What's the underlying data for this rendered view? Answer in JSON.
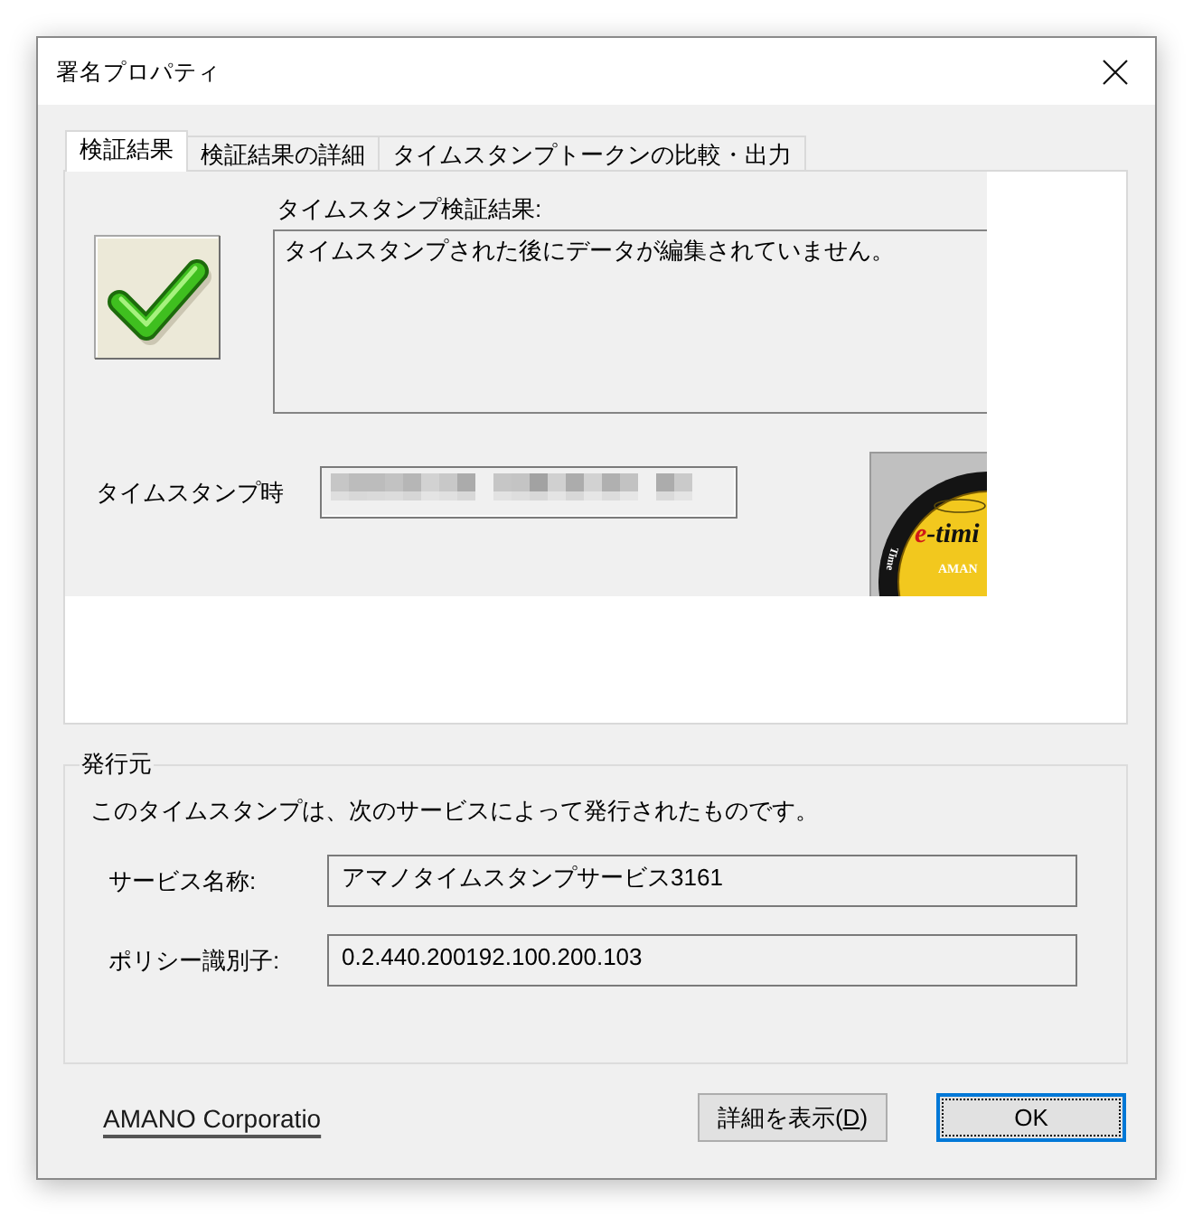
{
  "window": {
    "title": "署名プロパティ"
  },
  "tabs": [
    {
      "label": "検証結果",
      "selected": true
    },
    {
      "label": "検証結果の詳細",
      "selected": false
    },
    {
      "label": "タイムスタンプトークンの比較・出力",
      "selected": false
    }
  ],
  "verification": {
    "label": "タイムスタンプ検証結果:",
    "message": "タイムスタンプされた後にデータが編集されていません。",
    "valid": true
  },
  "timestamp": {
    "label": "タイムスタンプ時",
    "redacted": true
  },
  "seal_logo": {
    "wordmark": "e-timi",
    "maker": "AMAN",
    "band": "Time"
  },
  "issuer": {
    "title": "発行元",
    "description": "このタイムスタンプは、次のサービスによって発行されたものです。",
    "fields": [
      {
        "label": "サービス名称:",
        "value": "アマノタイムスタンプサービス3161"
      },
      {
        "label": "ポリシー識別子:",
        "value": "0.2.440.200192.100.200.103"
      }
    ]
  },
  "footer": {
    "link": "AMANO Corporatio",
    "buttons": [
      {
        "label": "詳細を表示(",
        "access_key": "D",
        "label_after": ")",
        "default": false,
        "focused": false
      },
      {
        "label": "OK",
        "default": true,
        "focused": true
      }
    ]
  }
}
